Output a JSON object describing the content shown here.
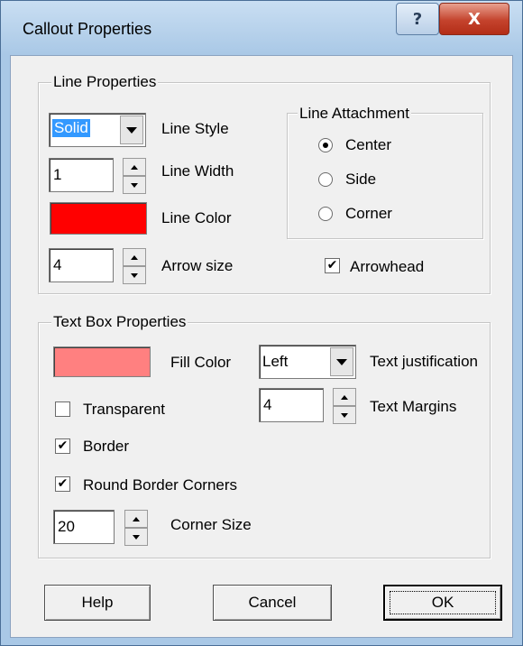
{
  "window": {
    "title": "Callout Properties",
    "help_glyph": "?",
    "close_glyph": "X"
  },
  "line_properties": {
    "legend": "Line Properties",
    "line_style": {
      "value": "Solid",
      "label": "Line Style"
    },
    "line_width": {
      "value": "1",
      "label": "Line Width"
    },
    "line_color": {
      "color": "#ff0000",
      "label": "Line Color"
    },
    "arrow_size": {
      "value": "4",
      "label": "Arrow size"
    },
    "attachment": {
      "legend": "Line Attachment",
      "options": [
        "Center",
        "Side",
        "Corner"
      ],
      "selected": "Center"
    },
    "arrowhead": {
      "label": "Arrowhead",
      "checked": true
    }
  },
  "text_box_properties": {
    "legend": "Text Box Properties",
    "fill_color": {
      "color": "#ff8080",
      "label": "Fill Color"
    },
    "text_justification": {
      "value": "Left",
      "label": "Text justification"
    },
    "text_margins": {
      "value": "4",
      "label": "Text Margins"
    },
    "transparent": {
      "label": "Transparent",
      "checked": false
    },
    "border": {
      "label": "Border",
      "checked": true
    },
    "round_corners": {
      "label": "Round Border Corners",
      "checked": true
    },
    "corner_size": {
      "value": "20",
      "label": "Corner Size"
    }
  },
  "buttons": {
    "help": "Help",
    "cancel": "Cancel",
    "ok": "OK"
  },
  "check_glyph": "✔"
}
